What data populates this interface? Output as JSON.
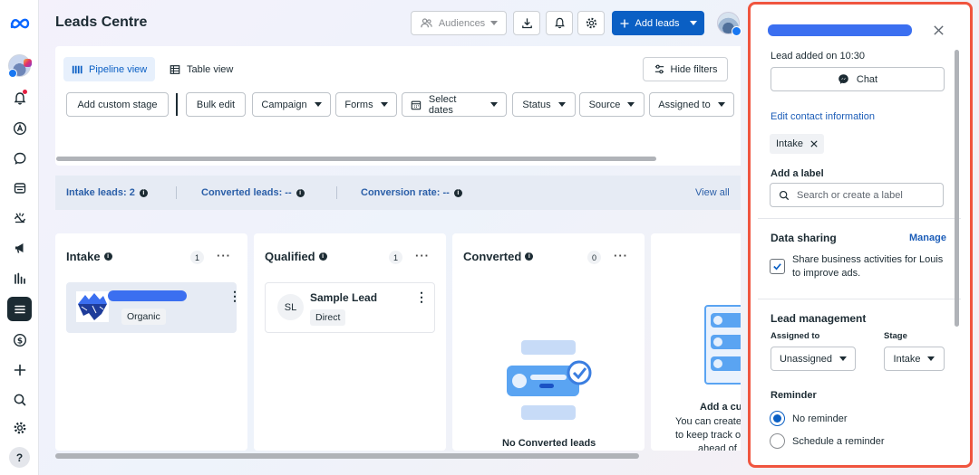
{
  "header": {
    "title": "Leads Centre",
    "audiences_label": "Audiences",
    "add_leads_label": "Add leads"
  },
  "views": {
    "pipeline": "Pipeline view",
    "table": "Table view",
    "hide_filters": "Hide filters"
  },
  "filters": {
    "add_custom_stage": "Add custom stage",
    "bulk_edit": "Bulk edit",
    "campaign": "Campaign",
    "forms": "Forms",
    "select_dates": "Select dates",
    "status": "Status",
    "source": "Source",
    "assigned_to": "Assigned to"
  },
  "stats": {
    "intake": "Intake leads: 2",
    "converted": "Converted leads: --",
    "rate": "Conversion rate: --",
    "view_all": "View all"
  },
  "columns": [
    {
      "title": "Intake",
      "count": "1",
      "more": "···"
    },
    {
      "title": "Qualified",
      "count": "1",
      "more": "···"
    },
    {
      "title": "Converted",
      "count": "0",
      "more": "···"
    }
  ],
  "cards": {
    "intake_tag": "Organic",
    "sample_initials": "SL",
    "sample_name": "Sample Lead",
    "sample_tag": "Direct"
  },
  "empty_converted": "No Converted leads",
  "partial_column": {
    "title": "Add a cu",
    "line1": "You can create",
    "line2": "to keep track o",
    "line3": "ahead of"
  },
  "panel": {
    "lead_added": "Lead added on 10:30",
    "chat": "Chat",
    "edit_contact": "Edit contact information",
    "stage_chip": "Intake",
    "add_label": "Add a label",
    "label_placeholder": "Search or create a label",
    "data_sharing": "Data sharing",
    "manage": "Manage",
    "share_text_1": "Share business activities for Louis",
    "share_text_2": "to improve ads.",
    "lead_management": "Lead management",
    "assigned_to": "Assigned to",
    "stage": "Stage",
    "assigned_value": "Unassigned",
    "stage_value": "Intake",
    "reminder": "Reminder",
    "no_reminder": "No reminder",
    "schedule_reminder": "Schedule a reminder"
  },
  "colors": {
    "accent": "#0a5fc4",
    "highlight_border": "#f0553f",
    "redacted_bar": "#3b6ff0"
  },
  "icons": [
    "meta-logo-icon",
    "notifications-icon",
    "ads-icon",
    "messages-icon",
    "content-icon",
    "planner-icon",
    "megaphone-icon",
    "insights-icon",
    "menu-icon",
    "billing-icon",
    "add-icon",
    "search-icon",
    "settings-icon",
    "help-icon"
  ]
}
